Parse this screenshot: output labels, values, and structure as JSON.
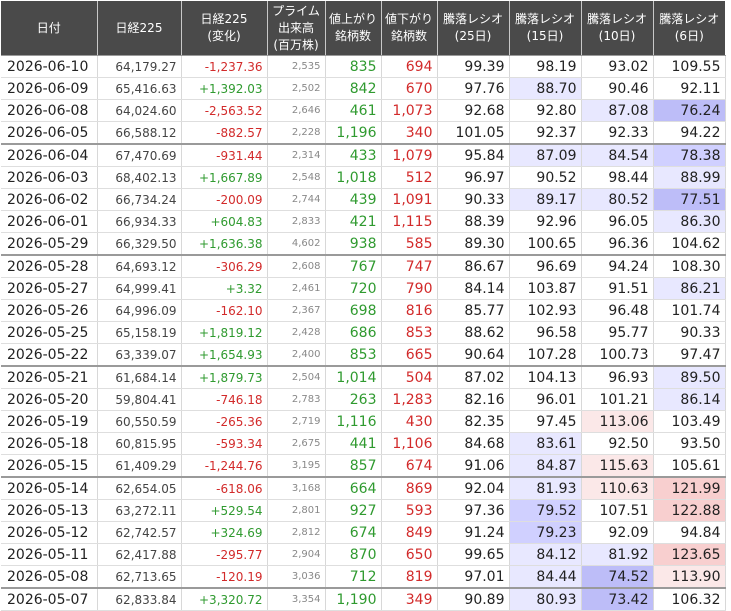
{
  "headers": [
    [
      "日付"
    ],
    [
      "日経225"
    ],
    [
      "日経225",
      "(変化)"
    ],
    [
      "プライム",
      "出来高",
      "(百万株)"
    ],
    [
      "値上がり",
      "銘柄数"
    ],
    [
      "値下がり",
      "銘柄数"
    ],
    [
      "騰落レシオ",
      "(25日)"
    ],
    [
      "騰落レシオ",
      "(15日)"
    ],
    [
      "騰落レシオ",
      "(10日)"
    ],
    [
      "騰落レシオ",
      "(6日)"
    ]
  ],
  "rows": [
    {
      "date": "2026-06-10",
      "nikkei": "64,179.27",
      "change": "-1,237.36",
      "volume": "2,535",
      "advances": "835",
      "declines": "694",
      "r25": "99.39",
      "r15": "98.19",
      "r10": "93.02",
      "r6": "109.55"
    },
    {
      "date": "2026-06-09",
      "nikkei": "65,416.63",
      "change": "+1,392.03",
      "volume": "2,502",
      "advances": "842",
      "declines": "670",
      "r25": "97.76",
      "r15": "88.70",
      "r10": "90.46",
      "r6": "92.11"
    },
    {
      "date": "2026-06-08",
      "nikkei": "64,024.60",
      "change": "-2,563.52",
      "volume": "2,646",
      "advances": "461",
      "declines": "1,073",
      "r25": "92.68",
      "r15": "92.80",
      "r10": "87.08",
      "r6": "76.24"
    },
    {
      "date": "2026-06-05",
      "nikkei": "66,588.12",
      "change": "-882.57",
      "volume": "2,228",
      "advances": "1,196",
      "declines": "340",
      "r25": "101.05",
      "r15": "92.37",
      "r10": "92.33",
      "r6": "94.22"
    },
    {
      "date": "2026-06-04",
      "nikkei": "67,470.69",
      "change": "-931.44",
      "volume": "2,314",
      "advances": "433",
      "declines": "1,079",
      "r25": "95.84",
      "r15": "87.09",
      "r10": "84.54",
      "r6": "78.38"
    },
    {
      "date": "2026-06-03",
      "nikkei": "68,402.13",
      "change": "+1,667.89",
      "volume": "2,548",
      "advances": "1,018",
      "declines": "512",
      "r25": "96.97",
      "r15": "90.52",
      "r10": "98.44",
      "r6": "88.99"
    },
    {
      "date": "2026-06-02",
      "nikkei": "66,734.24",
      "change": "-200.09",
      "volume": "2,744",
      "advances": "439",
      "declines": "1,091",
      "r25": "90.33",
      "r15": "89.17",
      "r10": "80.52",
      "r6": "77.51"
    },
    {
      "date": "2026-06-01",
      "nikkei": "66,934.33",
      "change": "+604.83",
      "volume": "2,833",
      "advances": "421",
      "declines": "1,115",
      "r25": "88.39",
      "r15": "92.96",
      "r10": "96.05",
      "r6": "86.30"
    },
    {
      "date": "2026-05-29",
      "nikkei": "66,329.50",
      "change": "+1,636.38",
      "volume": "4,602",
      "advances": "938",
      "declines": "585",
      "r25": "89.30",
      "r15": "100.65",
      "r10": "96.36",
      "r6": "104.62"
    },
    {
      "date": "2026-05-28",
      "nikkei": "64,693.12",
      "change": "-306.29",
      "volume": "2,608",
      "advances": "767",
      "declines": "747",
      "r25": "86.67",
      "r15": "96.69",
      "r10": "94.24",
      "r6": "108.30"
    },
    {
      "date": "2026-05-27",
      "nikkei": "64,999.41",
      "change": "+3.32",
      "volume": "2,461",
      "advances": "720",
      "declines": "790",
      "r25": "84.14",
      "r15": "103.87",
      "r10": "91.51",
      "r6": "86.21"
    },
    {
      "date": "2026-05-26",
      "nikkei": "64,996.09",
      "change": "-162.10",
      "volume": "2,367",
      "advances": "698",
      "declines": "816",
      "r25": "85.77",
      "r15": "102.93",
      "r10": "96.48",
      "r6": "101.74"
    },
    {
      "date": "2026-05-25",
      "nikkei": "65,158.19",
      "change": "+1,819.12",
      "volume": "2,428",
      "advances": "686",
      "declines": "853",
      "r25": "88.62",
      "r15": "96.58",
      "r10": "95.77",
      "r6": "90.33"
    },
    {
      "date": "2026-05-22",
      "nikkei": "63,339.07",
      "change": "+1,654.93",
      "volume": "2,400",
      "advances": "853",
      "declines": "665",
      "r25": "90.64",
      "r15": "107.28",
      "r10": "100.73",
      "r6": "97.47"
    },
    {
      "date": "2026-05-21",
      "nikkei": "61,684.14",
      "change": "+1,879.73",
      "volume": "2,504",
      "advances": "1,014",
      "declines": "504",
      "r25": "87.02",
      "r15": "104.13",
      "r10": "96.93",
      "r6": "89.50"
    },
    {
      "date": "2026-05-20",
      "nikkei": "59,804.41",
      "change": "-746.18",
      "volume": "2,783",
      "advances": "263",
      "declines": "1,283",
      "r25": "82.16",
      "r15": "96.01",
      "r10": "101.21",
      "r6": "86.14"
    },
    {
      "date": "2026-05-19",
      "nikkei": "60,550.59",
      "change": "-265.36",
      "volume": "2,719",
      "advances": "1,116",
      "declines": "430",
      "r25": "82.35",
      "r15": "97.45",
      "r10": "113.06",
      "r6": "103.49"
    },
    {
      "date": "2026-05-18",
      "nikkei": "60,815.95",
      "change": "-593.34",
      "volume": "2,675",
      "advances": "441",
      "declines": "1,106",
      "r25": "84.68",
      "r15": "83.61",
      "r10": "92.50",
      "r6": "93.50"
    },
    {
      "date": "2026-05-15",
      "nikkei": "61,409.29",
      "change": "-1,244.76",
      "volume": "3,195",
      "advances": "857",
      "declines": "674",
      "r25": "91.06",
      "r15": "84.87",
      "r10": "115.63",
      "r6": "105.61"
    },
    {
      "date": "2026-05-14",
      "nikkei": "62,654.05",
      "change": "-618.06",
      "volume": "3,168",
      "advances": "664",
      "declines": "869",
      "r25": "92.04",
      "r15": "81.93",
      "r10": "110.63",
      "r6": "121.99"
    },
    {
      "date": "2026-05-13",
      "nikkei": "63,272.11",
      "change": "+529.54",
      "volume": "2,801",
      "advances": "927",
      "declines": "593",
      "r25": "97.36",
      "r15": "79.52",
      "r10": "107.51",
      "r6": "122.88"
    },
    {
      "date": "2026-05-12",
      "nikkei": "62,742.57",
      "change": "+324.69",
      "volume": "2,812",
      "advances": "674",
      "declines": "849",
      "r25": "91.24",
      "r15": "79.23",
      "r10": "92.09",
      "r6": "94.84"
    },
    {
      "date": "2026-05-11",
      "nikkei": "62,417.88",
      "change": "-295.77",
      "volume": "2,904",
      "advances": "870",
      "declines": "650",
      "r25": "99.65",
      "r15": "84.12",
      "r10": "81.92",
      "r6": "123.65"
    },
    {
      "date": "2026-05-08",
      "nikkei": "62,713.65",
      "change": "-120.19",
      "volume": "3,036",
      "advances": "712",
      "declines": "819",
      "r25": "97.01",
      "r15": "84.44",
      "r10": "74.52",
      "r6": "113.90"
    },
    {
      "date": "2026-05-07",
      "nikkei": "62,833.84",
      "change": "+3,320.72",
      "volume": "3,354",
      "advances": "1,190",
      "declines": "349",
      "r25": "90.89",
      "r15": "80.93",
      "r10": "73.42",
      "r6": "106.32"
    }
  ],
  "colors": {
    "header_bg": "#4a4a4a",
    "header_text": "#ffffff",
    "up": "#2f9a2f",
    "down": "#d22a2a",
    "volume_text": "#888888",
    "low_ratio_bg": "#d0d0ff",
    "high_ratio_bg": "#f8cfcf"
  }
}
